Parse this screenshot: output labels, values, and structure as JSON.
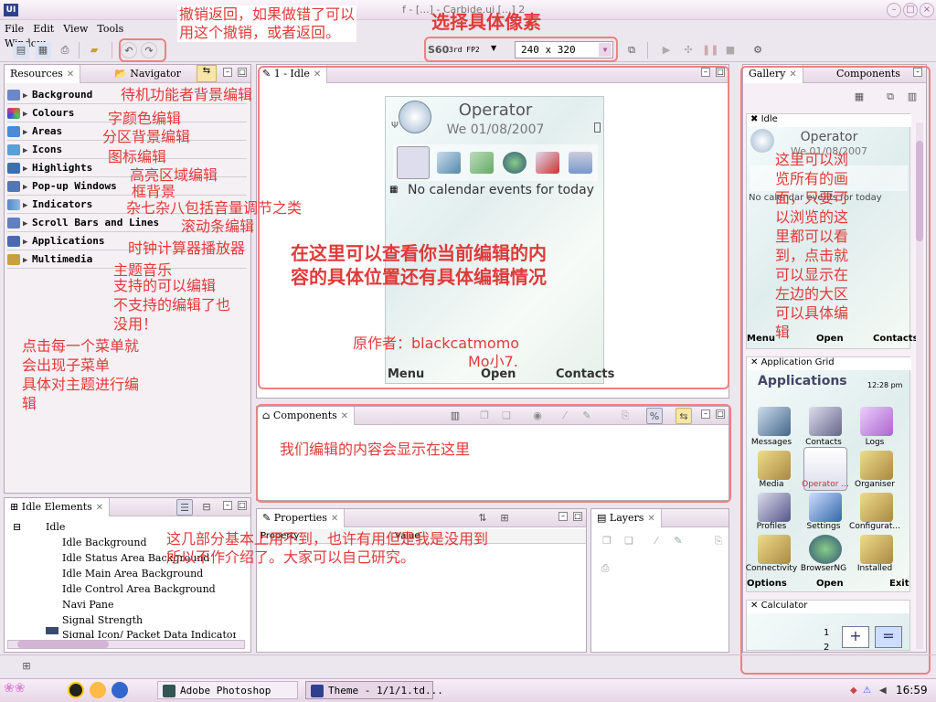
{
  "window": {
    "title": "f - [...] - Carbide.ui [...] 2",
    "app_icon": "UI"
  },
  "menu": [
    "File",
    "Edit",
    "View",
    "Tools",
    "Window"
  ],
  "toolbar": {
    "platform_label": "S60",
    "platform_version": "3rd FP2",
    "resolution": "240 x 320"
  },
  "resources": {
    "tabs": [
      "Resources",
      "Navigator"
    ],
    "items": [
      "Background",
      "Colours",
      "Areas",
      "Icons",
      "Highlights",
      "Pop-up Windows",
      "Indicators",
      "Scroll Bars and Lines",
      "Applications",
      "Multimedia"
    ]
  },
  "editor": {
    "tab": "1 - Idle",
    "phone": {
      "operator": "Operator",
      "date": "We 01/08/2007",
      "calendar": "No calendar events for today",
      "soft_left": "Menu",
      "soft_center": "Open",
      "soft_right": "Contacts"
    }
  },
  "components": {
    "tab": "Components"
  },
  "idle_elements": {
    "tab": "Idle Elements",
    "root": "Idle",
    "children": [
      "Idle Background",
      "Idle Status Area Background",
      "Idle Main Area Background",
      "Idle Control Area Background",
      "Navi Pane",
      "Signal Strength",
      "Signal Icon/ Packet Data Indicator"
    ]
  },
  "properties": {
    "tab": "Properties",
    "col1": "Property",
    "col2": "Value"
  },
  "layers": {
    "tab": "Layers"
  },
  "gallery": {
    "tabs": [
      "Gallery",
      "Components"
    ],
    "idle": {
      "title": "Idle",
      "operator": "Operator",
      "date": "We 01/08/2007",
      "calendar": "No calendar events for today",
      "soft_left": "Menu",
      "soft_center": "Open",
      "soft_right": "Contacts"
    },
    "app_grid": {
      "title": "Application Grid",
      "header": "Applications",
      "time": "12:28 pm",
      "apps": [
        "Messages",
        "Contacts",
        "Logs",
        "Media",
        "Operator ...",
        "Organiser",
        "Profiles",
        "Settings",
        "Configurat...",
        "Connectivity",
        "BrowserNG",
        "Installed"
      ],
      "soft_left": "Options",
      "soft_center": "Open",
      "soft_right": "Exit"
    },
    "calculator": {
      "title": "Calculator",
      "value1": "1",
      "value2": "2",
      "plus": "+",
      "equals": "="
    }
  },
  "annotations": {
    "undo": [
      "撤销返回，如果做错了可以",
      "用这个撤销，或者返回。"
    ],
    "pixel": "选择具体像素",
    "background": "待机功能者背景编辑",
    "colours": "字颜色编辑",
    "areas": "分区背景编辑",
    "icons": "图标编辑",
    "highlights": "高亮区域编辑",
    "popup": "框背景",
    "indicators": "杂七杂八包括音量调节之类",
    "scroll": "滚动条编辑",
    "apps": "时钟计算器播放器",
    "multimedia": "主题音乐",
    "support": [
      "支持的可以编辑",
      "不支持的编辑了也",
      "没用！"
    ],
    "menu_tip": [
      "点击每一个菜单就",
      "会出现子菜单",
      "具体对主题进行编",
      "辑"
    ],
    "editor_tip": [
      "在这里可以查看你当前编辑的内",
      "容的具体位置还有具体编辑情况"
    ],
    "author": "原作者：blackcatmomo",
    "author2": "Mo小7.",
    "components_tip": "我们编辑的内容会显示在这里",
    "bottom_tip": [
      "这几部分基本上用不到，也许有用但是我是没用到",
      "所以不作介绍了。大家可以自己研究。"
    ],
    "gallery_tip": [
      "这里可以浏",
      "览所有的画",
      "面，只要可",
      "以浏览的这",
      "里都可以看",
      "到，点击就",
      "可以显示在",
      "左边的大区",
      "可以具体编",
      "辑"
    ]
  },
  "taskbar": {
    "photoshop": "Adobe Photoshop",
    "theme": "Theme - 1/1/1.td...",
    "clock": "16:59"
  }
}
